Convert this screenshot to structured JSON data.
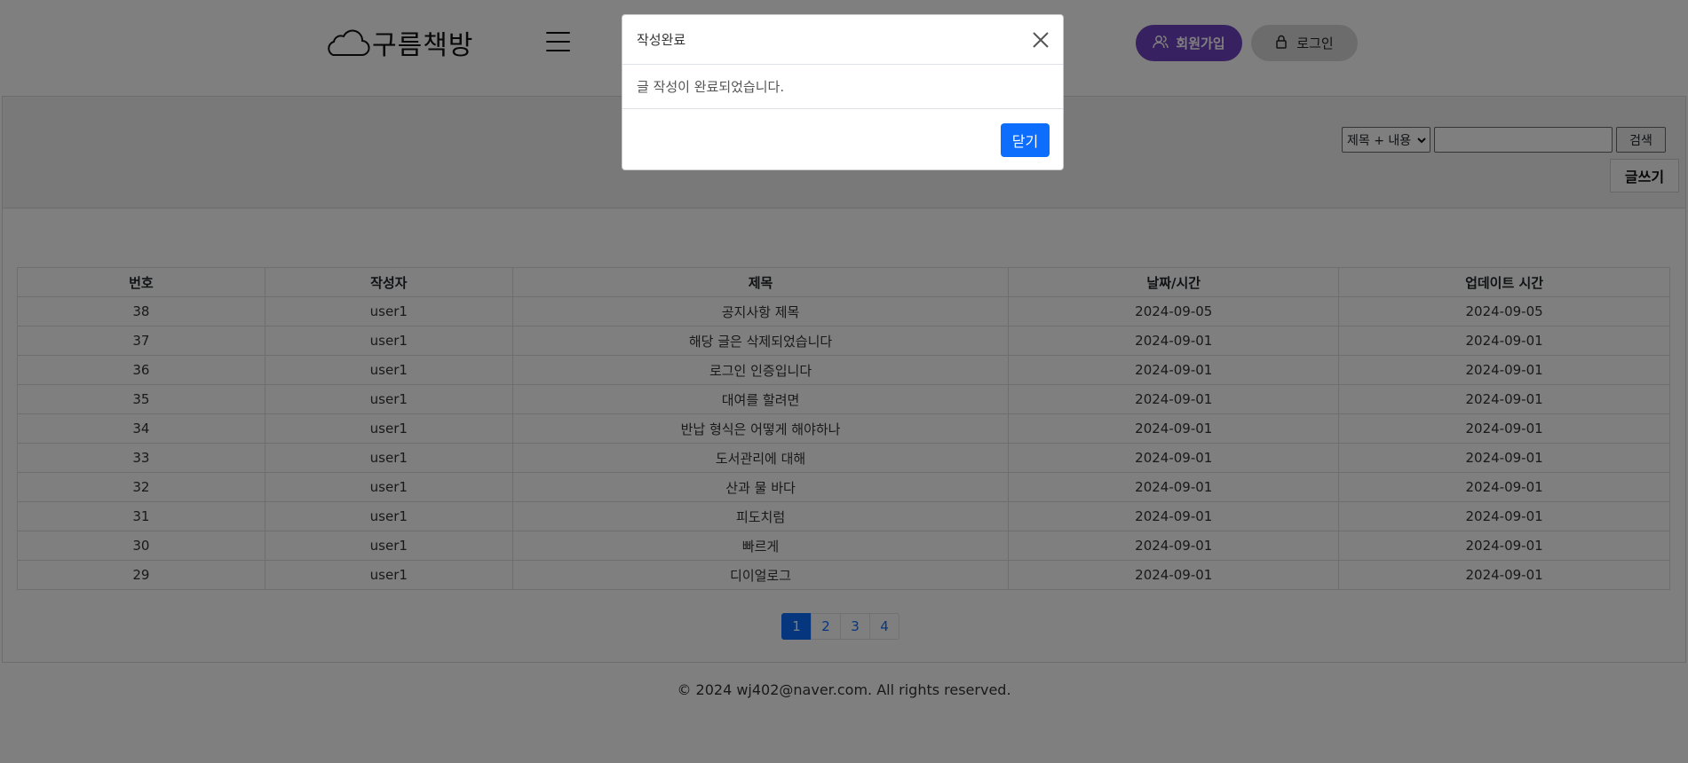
{
  "header": {
    "logo_text": "구름책방",
    "signup_label": "회원가입",
    "login_label": "로그인"
  },
  "board": {
    "write_label": "글쓰기",
    "search": {
      "select_value": "제목 + 내용",
      "input_value": "",
      "button_label": "검색"
    },
    "columns": [
      "번호",
      "작성자",
      "제목",
      "날짜/시간",
      "업데이트 시간"
    ],
    "rows": [
      {
        "no": "38",
        "author": "user1",
        "title": "공지사항 제목",
        "date": "2024-09-05",
        "updated": "2024-09-05"
      },
      {
        "no": "37",
        "author": "user1",
        "title": "해당 글은 삭제되었습니다",
        "date": "2024-09-01",
        "updated": "2024-09-01"
      },
      {
        "no": "36",
        "author": "user1",
        "title": "로그인 인증입니다",
        "date": "2024-09-01",
        "updated": "2024-09-01"
      },
      {
        "no": "35",
        "author": "user1",
        "title": "대여를 할려면",
        "date": "2024-09-01",
        "updated": "2024-09-01"
      },
      {
        "no": "34",
        "author": "user1",
        "title": "반납 형식은 어떻게 해야하나",
        "date": "2024-09-01",
        "updated": "2024-09-01"
      },
      {
        "no": "33",
        "author": "user1",
        "title": "도서관리에 대해",
        "date": "2024-09-01",
        "updated": "2024-09-01"
      },
      {
        "no": "32",
        "author": "user1",
        "title": "산과 물 바다",
        "date": "2024-09-01",
        "updated": "2024-09-01"
      },
      {
        "no": "31",
        "author": "user1",
        "title": "피도치럼",
        "date": "2024-09-01",
        "updated": "2024-09-01"
      },
      {
        "no": "30",
        "author": "user1",
        "title": "빠르게",
        "date": "2024-09-01",
        "updated": "2024-09-01"
      },
      {
        "no": "29",
        "author": "user1",
        "title": "디이얼로그",
        "date": "2024-09-01",
        "updated": "2024-09-01"
      }
    ],
    "pages": [
      "1",
      "2",
      "3",
      "4"
    ],
    "active_page": "1"
  },
  "footer": {
    "text": "© 2024 wj402@naver.com. All rights reserved."
  },
  "modal": {
    "title": "작성완료",
    "message": "글 작성이 완료되었습니다.",
    "ok_label": "닫기"
  },
  "colors": {
    "signup_bg": "#6f42c1",
    "primary": "#0d6efd",
    "backdrop": "rgba(0,0,0,0.5)"
  },
  "icons": {
    "logo": "cloud-icon",
    "menu": "hamburger-menu-icon",
    "signup": "users-icon",
    "login": "lock-icon",
    "close": "close-icon",
    "select": "chevron-down-icon"
  }
}
